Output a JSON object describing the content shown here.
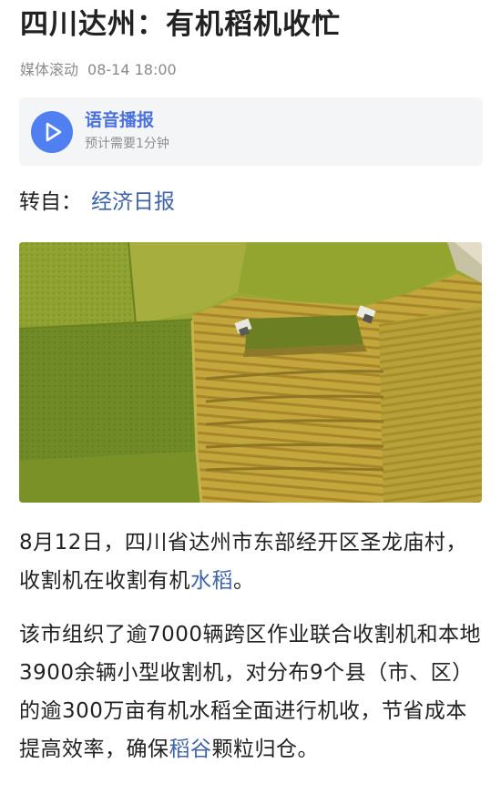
{
  "article": {
    "title": "四川达州：有机稻机收忙",
    "meta": {
      "media": "媒体滚动",
      "time": "08-14 18:00"
    },
    "audio": {
      "title": "语音播报",
      "subtitle": "预计需要1分钟",
      "icon": "play-icon"
    },
    "source": {
      "label": "转自：",
      "name": "经济日报"
    },
    "photo": {
      "description_icon": "rice-field-aerial-photo"
    },
    "paragraph1": {
      "text_a": "8月12日，四川省达州市东部经开区圣龙庙村，收割机在收割有机",
      "link": "水稻",
      "text_b": "。"
    },
    "paragraph2": {
      "text_a": "该市组织了逾7000辆跨区作业联合收割机和本地3900余辆小型收割机，对分布9个县（市、区）的逾300万亩有机水稻全面进行机收，节省成本提高效率，确保",
      "link": "稻谷",
      "text_b": "颗粒归仓。"
    }
  },
  "colors": {
    "link": "#3f63a8",
    "accent": "#4f7ff0",
    "card_bg": "#f4f5f7",
    "meta_text": "#8a8a8a"
  }
}
